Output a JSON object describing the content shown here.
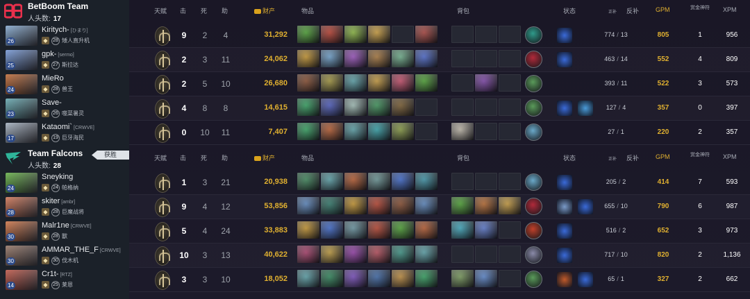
{
  "teams": [
    {
      "name": "BetBoom Team",
      "kills_label": "人头数:",
      "kills": "17",
      "logo_color": "#e8304c",
      "header": {
        "talent": "天赋",
        "kills": "击",
        "deaths": "死",
        "assists": "助",
        "networth": "财产",
        "items": "物品",
        "backpack": "背包",
        "status": "状态",
        "lh_small": "正补",
        "lh": "反补",
        "gpm": "GPM",
        "bounty": "赏金神符",
        "xpm": "XPM"
      },
      "players": [
        {
          "name": "Kiritych-",
          "tag": "[ひまり]",
          "rank": "28",
          "hero_cn": "矮人直升机",
          "hero_level": "26",
          "hero_color": "#7aa0c8",
          "kills": "9",
          "deaths": "2",
          "assists": "4",
          "networth": "31,292",
          "items": [
            "#4aa82e",
            "#c23a2a",
            "#8ec03c",
            "#d6a43a",
            "empty",
            "#b0403a"
          ],
          "backpack": [
            "empty",
            "empty",
            "empty"
          ],
          "neutral": "#2f9a8a",
          "buffs": [
            "#3a6ad8"
          ],
          "lh": "774",
          "dn": "13",
          "gpm": "805",
          "bounty": "1",
          "xpm": "956"
        },
        {
          "name": "gpk-",
          "tag": "[sermo]",
          "rank": "27",
          "hero_cn": "斯拉达",
          "hero_level": "25",
          "hero_color": "#6a8fd0",
          "kills": "2",
          "deaths": "3",
          "assists": "11",
          "networth": "24,062",
          "items": [
            "#d09a2a",
            "#6fa8d8",
            "#a050c8",
            "#b07a3a",
            "#70b890",
            "#4a6ad8"
          ],
          "backpack": [
            "empty",
            "empty",
            "empty"
          ],
          "neutral": "#b02a3a",
          "buffs": [
            "#3a6ad8"
          ],
          "lh": "463",
          "dn": "14",
          "gpm": "552",
          "bounty": "4",
          "xpm": "809"
        },
        {
          "name": "MieRo",
          "tag": "",
          "rank": "28",
          "hero_cn": "兽王",
          "hero_level": "24",
          "hero_color": "#b8602a",
          "kills": "2",
          "deaths": "5",
          "assists": "10",
          "networth": "26,680",
          "items": [
            "#8a4a2a",
            "#a89a3a",
            "#5aa8b0",
            "#d0a03a",
            "#d04a6a",
            "#4aa82e"
          ],
          "backpack": [
            "empty",
            "#8040b0",
            "empty"
          ],
          "neutral": "#5a9a5a",
          "buffs": [],
          "lh": "393",
          "dn": "11",
          "gpm": "522",
          "bounty": "3",
          "xpm": "573"
        },
        {
          "name": "Save-",
          "tag": "",
          "rank": "26",
          "hero_cn": "噬菜暑灵",
          "hero_level": "23",
          "hero_color": "#5aa0a8",
          "kills": "4",
          "deaths": "8",
          "assists": "8",
          "networth": "14,615",
          "items": [
            "#2ea860",
            "#4a5ac8",
            "#a8c8c0",
            "#3a9a5a",
            "#7a5a2a",
            "empty"
          ],
          "backpack": [
            "empty",
            "empty",
            "empty"
          ],
          "neutral": "#5a9a5a",
          "buffs": [
            "#3a6ad8",
            "#4a9ad8"
          ],
          "lh": "127",
          "dn": "4",
          "gpm": "357",
          "bounty": "0",
          "xpm": "397"
        },
        {
          "name": "Kataomi`",
          "tag": "[CRWVE]",
          "rank": "19",
          "hero_cn": "巨牙海民",
          "hero_level": "17",
          "hero_color": "#9aa8b8",
          "kills": "0",
          "deaths": "10",
          "assists": "11",
          "networth": "7,407",
          "items": [
            "#2ea860",
            "#c05a2a",
            "#5aa8b0",
            "#2ea8b0",
            "#8aa040",
            "empty"
          ],
          "backpack": [
            "#c8c0b0",
            "empty",
            "empty"
          ],
          "neutral": "#6aa8c8",
          "buffs": [],
          "lh": "27",
          "dn": "1",
          "gpm": "220",
          "bounty": "2",
          "xpm": "357"
        }
      ]
    },
    {
      "name": "Team Falcons",
      "kills_label": "人头数:",
      "kills": "28",
      "logo_color": "#2fb59a",
      "win_label": "获胜",
      "header": {
        "talent": "天赋",
        "kills": "击",
        "deaths": "死",
        "assists": "助",
        "networth": "财产",
        "items": "物品",
        "backpack": "背包",
        "status": "状态",
        "lh_small": "正补",
        "lh": "反补",
        "gpm": "GPM",
        "bounty": "赏金神符",
        "xpm": "XPM"
      },
      "players": [
        {
          "name": "Sneyking",
          "tag": "",
          "rank": "24",
          "hero_cn": "帕格纳",
          "hero_level": "24",
          "hero_color": "#5aa83a",
          "kills": "1",
          "deaths": "3",
          "assists": "21",
          "networth": "20,938",
          "items": [
            "#3a8a5a",
            "#5aa8b0",
            "#c05a2a",
            "#6a9a9a",
            "#3a6ad8",
            "#3a9ab0"
          ],
          "backpack": [
            "empty",
            "empty",
            "empty"
          ],
          "neutral": "#6aa8c8",
          "buffs": [
            "#3a6ad8"
          ],
          "lh": "205",
          "dn": "2",
          "gpm": "414",
          "bounty": "7",
          "xpm": "593"
        },
        {
          "name": "skiter",
          "tag": "[ambr]",
          "rank": "28",
          "hero_cn": "巨魔战将",
          "hero_level": "28",
          "hero_color": "#c86a4a",
          "kills": "9",
          "deaths": "4",
          "assists": "12",
          "networth": "53,856",
          "items": [
            "#5a8ac8",
            "#2a7a6a",
            "#d09a2a",
            "#c0402a",
            "#8a4a2a",
            "#5a8ac8"
          ],
          "backpack": [
            "#4aa82e",
            "#c06a2a",
            "#d0a03a"
          ],
          "neutral": "#b02a3a",
          "buffs": [
            "#7a9ac8",
            "#3a6ad8"
          ],
          "lh": "655",
          "dn": "10",
          "gpm": "790",
          "bounty": "6",
          "xpm": "987"
        },
        {
          "name": "Malr1ne",
          "tag": "[CRWVE]",
          "rank": "28",
          "hero_cn": "獸",
          "hero_level": "30",
          "hero_color": "#c86a3a",
          "kills": "5",
          "deaths": "4",
          "assists": "24",
          "networth": "33,883",
          "items": [
            "#d09a2a",
            "#3a6ad8",
            "#6a9aa8",
            "#c0402a",
            "#4aa82e",
            "#c05a2a"
          ],
          "backpack": [
            "#3ab0c8",
            "#5a7ad8",
            "empty"
          ],
          "neutral": "#c0402a",
          "buffs": [
            "#3a6ad8"
          ],
          "lh": "516",
          "dn": "2",
          "gpm": "652",
          "bounty": "3",
          "xpm": "973"
        },
        {
          "name": "AMMAR_THE_F",
          "tag": "[CRWVE]",
          "rank": "30",
          "hero_cn": "伐木机",
          "hero_level": "30",
          "hero_color": "#8a6a5a",
          "kills": "10",
          "deaths": "3",
          "assists": "13",
          "networth": "40,622",
          "items": [
            "#b03a6a",
            "#c8a03a",
            "#9a3ab0",
            "#c04a5a",
            "#3a9a8a",
            "#5aa8b0"
          ],
          "backpack": [
            "empty",
            "empty",
            "empty"
          ],
          "neutral": "#8a8aa8",
          "buffs": [
            "#3a6ad8"
          ],
          "lh": "717",
          "dn": "10",
          "gpm": "820",
          "bounty": "2",
          "xpm": "1,136"
        },
        {
          "name": "Cr1t-",
          "tag": "[RTZ]",
          "rank": "25",
          "hero_cn": "莱恩",
          "hero_level": "14",
          "hero_color": "#b84a3a",
          "kills": "3",
          "deaths": "3",
          "assists": "10",
          "networth": "18,052",
          "items": [
            "#5aa8b0",
            "#2a8a5a",
            "#7a4ac8",
            "#3a6ab0",
            "#c8903a",
            "#2ea860"
          ],
          "backpack": [
            "#7aa05a",
            "#5a8ad8",
            "empty"
          ],
          "neutral": "#5a9a5a",
          "buffs": [
            "#c05a2a",
            "#3a6ad8"
          ],
          "lh": "65",
          "dn": "1",
          "gpm": "327",
          "bounty": "2",
          "xpm": "662"
        }
      ]
    }
  ]
}
